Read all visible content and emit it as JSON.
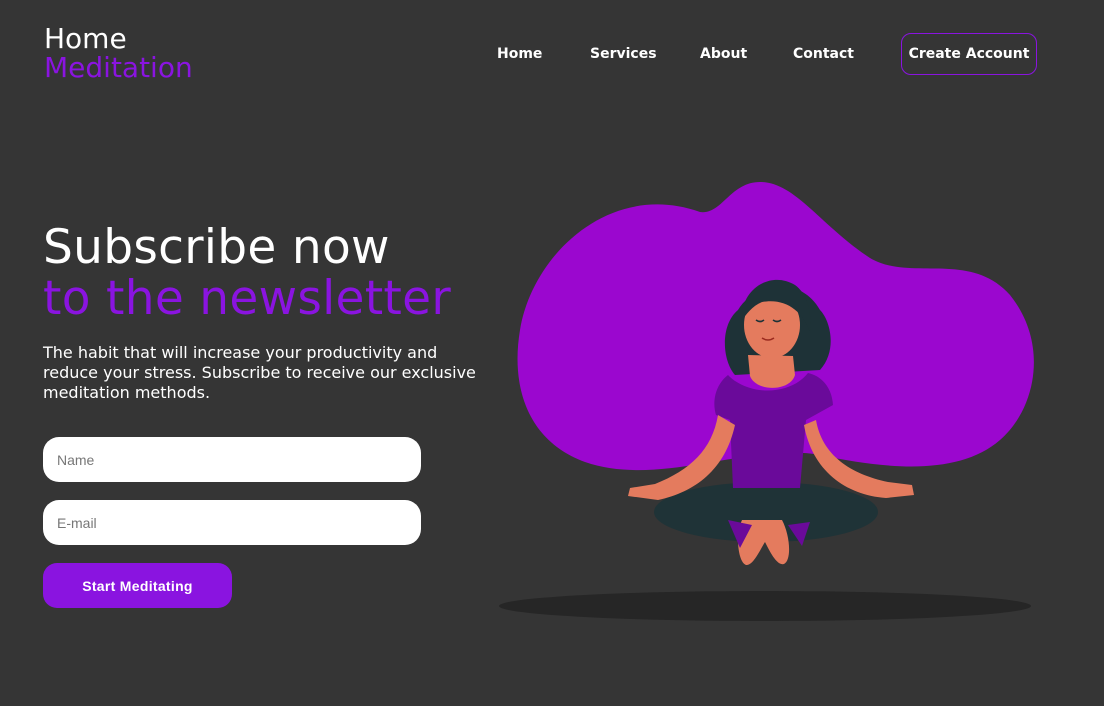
{
  "logo": {
    "line1": "Home",
    "line2": "Meditation"
  },
  "nav": {
    "items": [
      "Home",
      "Services",
      "About",
      "Contact"
    ],
    "cta": "Create Account"
  },
  "hero": {
    "title_line1": "Subscribe now",
    "title_line2": "to the newsletter",
    "description": "The habit that will increase your productivity and reduce your stress. Subscribe to receive our exclusive meditation methods."
  },
  "form": {
    "name_placeholder": "Name",
    "email_placeholder": "E-mail",
    "submit_label": "Start Meditating"
  },
  "colors": {
    "background": "#353535",
    "accent": "#8a14e0",
    "blob": "#9b07cf",
    "skin": "#e47b5e",
    "hair": "#1e3237"
  },
  "illustration": {
    "subject": "meditating-woman-illustration"
  }
}
